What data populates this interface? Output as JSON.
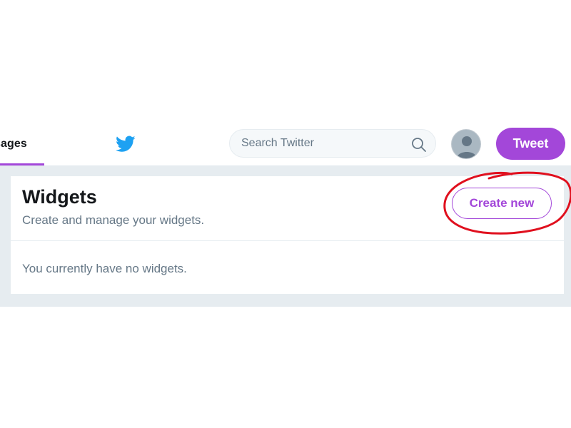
{
  "nav": {
    "active_tab_label": "sages",
    "search_placeholder": "Search Twitter",
    "tweet_button_label": "Tweet"
  },
  "widgets_card": {
    "title": "Widgets",
    "subtitle": "Create and manage your widgets.",
    "create_button_label": "Create new",
    "empty_message": "You currently have no widgets."
  },
  "colors": {
    "accent": "#a347d9",
    "twitter_blue": "#1da1f2",
    "annotation_red": "#e0101e"
  },
  "icons": {
    "brand": "twitter-bird-icon",
    "search": "search-icon",
    "avatar": "default-avatar-icon"
  }
}
